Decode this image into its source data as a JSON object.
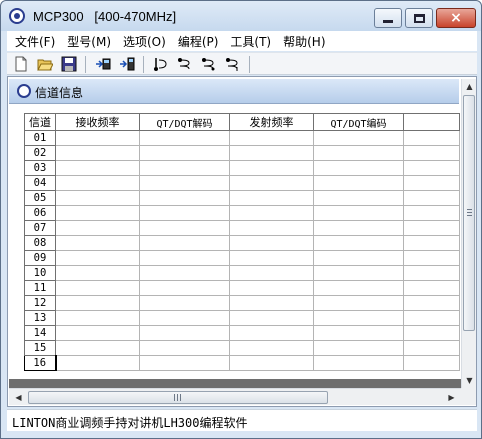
{
  "window": {
    "title": "MCP300   [400-470MHz]",
    "buttons": {
      "min": "minimize",
      "max": "maximize",
      "close": "×"
    }
  },
  "menu": [
    {
      "label": "文件(F)"
    },
    {
      "label": "型号(M)"
    },
    {
      "label": "选项(O)"
    },
    {
      "label": "编程(P)"
    },
    {
      "label": "工具(T)"
    },
    {
      "label": "帮助(H)"
    }
  ],
  "toolbar": {
    "icons": [
      "new-file-icon",
      "open-folder-icon",
      "save-disk-icon",
      "read-from-radio-icon",
      "write-to-radio-icon",
      "radio-tool-1-icon",
      "radio-tool-2-icon",
      "radio-tool-3-icon",
      "radio-tool-4-icon"
    ]
  },
  "child_window": {
    "title": "信道信息"
  },
  "grid": {
    "columns": [
      "信道",
      "接收频率",
      "QT/DQT解码",
      "发射频率",
      "QT/DQT编码",
      ""
    ],
    "rows": [
      "01",
      "02",
      "03",
      "04",
      "05",
      "06",
      "07",
      "08",
      "09",
      "10",
      "11",
      "12",
      "13",
      "14",
      "15",
      "16"
    ]
  },
  "scrollbars": {
    "vertical_glyph": "≡",
    "horizontal_glyph": "|||",
    "up": "▲",
    "down": "▼",
    "left": "◀",
    "right": "▶"
  },
  "status": {
    "text": "LINTON商业调频手持对讲机LH300编程软件"
  },
  "colors": {
    "title_gradient_top": "#dfeaf7",
    "child_title": "#b6cdea",
    "close_button": "#c8432b"
  }
}
